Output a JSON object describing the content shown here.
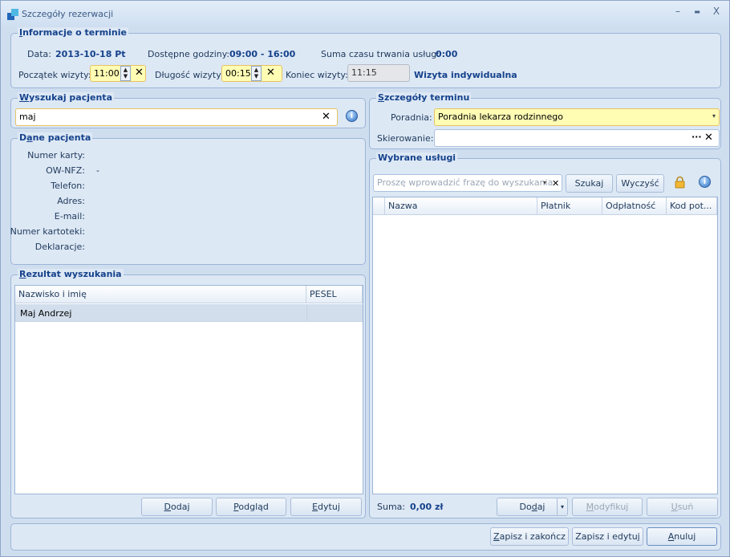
{
  "window": {
    "title": "Szczegóły rezerwacji",
    "min": "–",
    "max": "▬",
    "close": "X"
  },
  "term": {
    "title_u": "I",
    "title_rest": "nformacje o terminie",
    "data_label": "Data:",
    "data_value": "2013-10-18 Pt",
    "hours_label": "Dostępne godziny:",
    "hours_value": "09:00 - 16:00",
    "sum_label": "Suma czasu trwania usług:",
    "sum_value": "0:00",
    "start_label": "Początek wizyty:",
    "start_value": "11:00",
    "length_label": "Długość wizyty:",
    "length_value": "00:15",
    "end_label": "Koniec wizyty:",
    "end_value": "11:15",
    "type_value": "Wizyta indywidualna"
  },
  "search": {
    "title_u": "W",
    "title_rest": "yszukaj pacjenta",
    "value": "maj"
  },
  "patient": {
    "title_pre": "D",
    "title_u": "a",
    "title_rest": "ne pacjenta",
    "card": "Numer karty:",
    "ownfz": "OW-NFZ:",
    "ownfz_value": "-",
    "phone": "Telefon:",
    "address": "Adres:",
    "email": "E-mail:",
    "record": "Numer kartoteki:",
    "decl": "Deklaracje:"
  },
  "results": {
    "title_u": "R",
    "title_rest": "ezultat wyszukania",
    "col_name": "Nazwisko i imię",
    "col_pesel": "PESEL",
    "rows": [
      {
        "name": "Maj Andrzej",
        "pesel": ""
      }
    ],
    "add_u": "D",
    "add_rest": "odaj",
    "preview_u": "P",
    "preview_rest": "odgląd",
    "edit_u": "E",
    "edit_rest": "dytuj"
  },
  "term_details": {
    "title_u": "S",
    "title_rest": "zczegóły terminu",
    "clinic_label": "Poradnia:",
    "clinic_value": "Poradnia lekarza rodzinnego",
    "referral_label": "Skierowanie:",
    "referral_dots": "···"
  },
  "services": {
    "title": "Wybrane usługi",
    "search_placeholder": "Proszę wprowadzić frazę do wyszukania",
    "search_btn": "Szukaj",
    "clear_btn": "Wyczyść",
    "cols": [
      "Nazwa",
      "Płatnik",
      "Odpłatność",
      "Kod pot..."
    ],
    "sum_label": "Suma:",
    "sum_value": "0,00 zł",
    "add_pre": "Do",
    "add_u": "d",
    "add_rest": "aj",
    "modify_u": "M",
    "modify_rest": "odyfikuj",
    "delete_u": "U",
    "delete_rest": "suń"
  },
  "footer": {
    "save_close_u": "Z",
    "save_close_rest": "apisz i zakończ",
    "save_edit_pre": "Zapisz i edytu",
    "save_edit_u": "j",
    "cancel_u": "A",
    "cancel_rest": "nuluj"
  }
}
